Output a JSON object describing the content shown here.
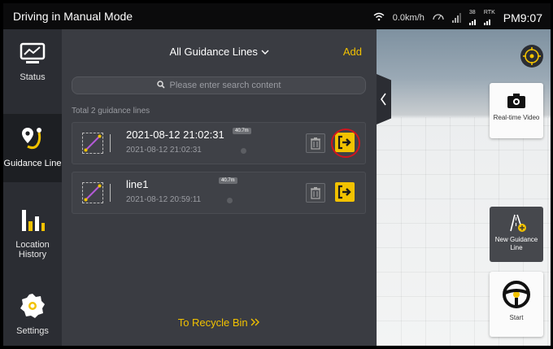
{
  "status_bar": {
    "title": "Driving in Manual Mode",
    "speed": "0.0km/h",
    "sat_count": "38",
    "rtk": "RTK",
    "clock": "PM9:07"
  },
  "sidebar": {
    "items": [
      {
        "label": "Status",
        "icon": "monitor-chart-icon"
      },
      {
        "label": "Guidance Line",
        "icon": "route-pin-icon",
        "active": true
      },
      {
        "label": "Location History",
        "icon": "bar-chart-icon"
      },
      {
        "label": "Settings",
        "icon": "gear-icon"
      }
    ]
  },
  "panel": {
    "filter_label": "All Guidance Lines",
    "add_label": "Add",
    "search_placeholder": "Please enter search content",
    "total_text": "Total 2 guidance lines",
    "lines": [
      {
        "name": "2021-08-12 21:02:31",
        "date": "2021-08-12 21:02:31",
        "length": "40.7m"
      },
      {
        "name": "line1",
        "date": "2021-08-12 20:59:11",
        "length": "40.7m"
      }
    ],
    "recycle_label": "To Recycle Bin"
  },
  "map": {
    "realtime_video_label": "Real-time Video",
    "new_guidance_label": "New Guidance Line",
    "start_label": "Start"
  },
  "colors": {
    "accent": "#f2c200",
    "highlight_ring": "#d0151e"
  }
}
